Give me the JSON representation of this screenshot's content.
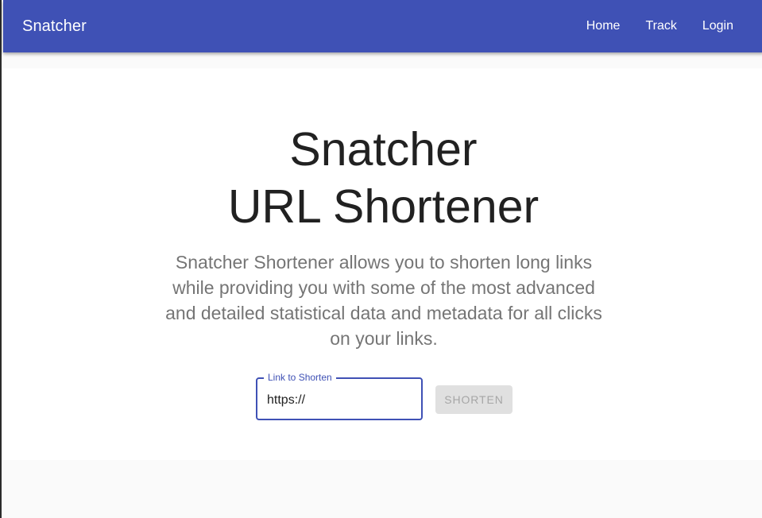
{
  "appbar": {
    "brand": "Snatcher",
    "nav": {
      "home": "Home",
      "track": "Track",
      "login": "Login"
    },
    "color": "#3f51b5"
  },
  "hero": {
    "title_line1": "Snatcher",
    "title_line2": "URL Shortener",
    "description": "Snatcher Shortener allows you to shorten long links while providing you with some of the most advanced and detailed statistical data and metadata for all clicks on your links."
  },
  "form": {
    "link_label": "Link to Shorten",
    "link_value": "https://",
    "shorten_label": "SHORTEN",
    "shorten_disabled": true
  }
}
